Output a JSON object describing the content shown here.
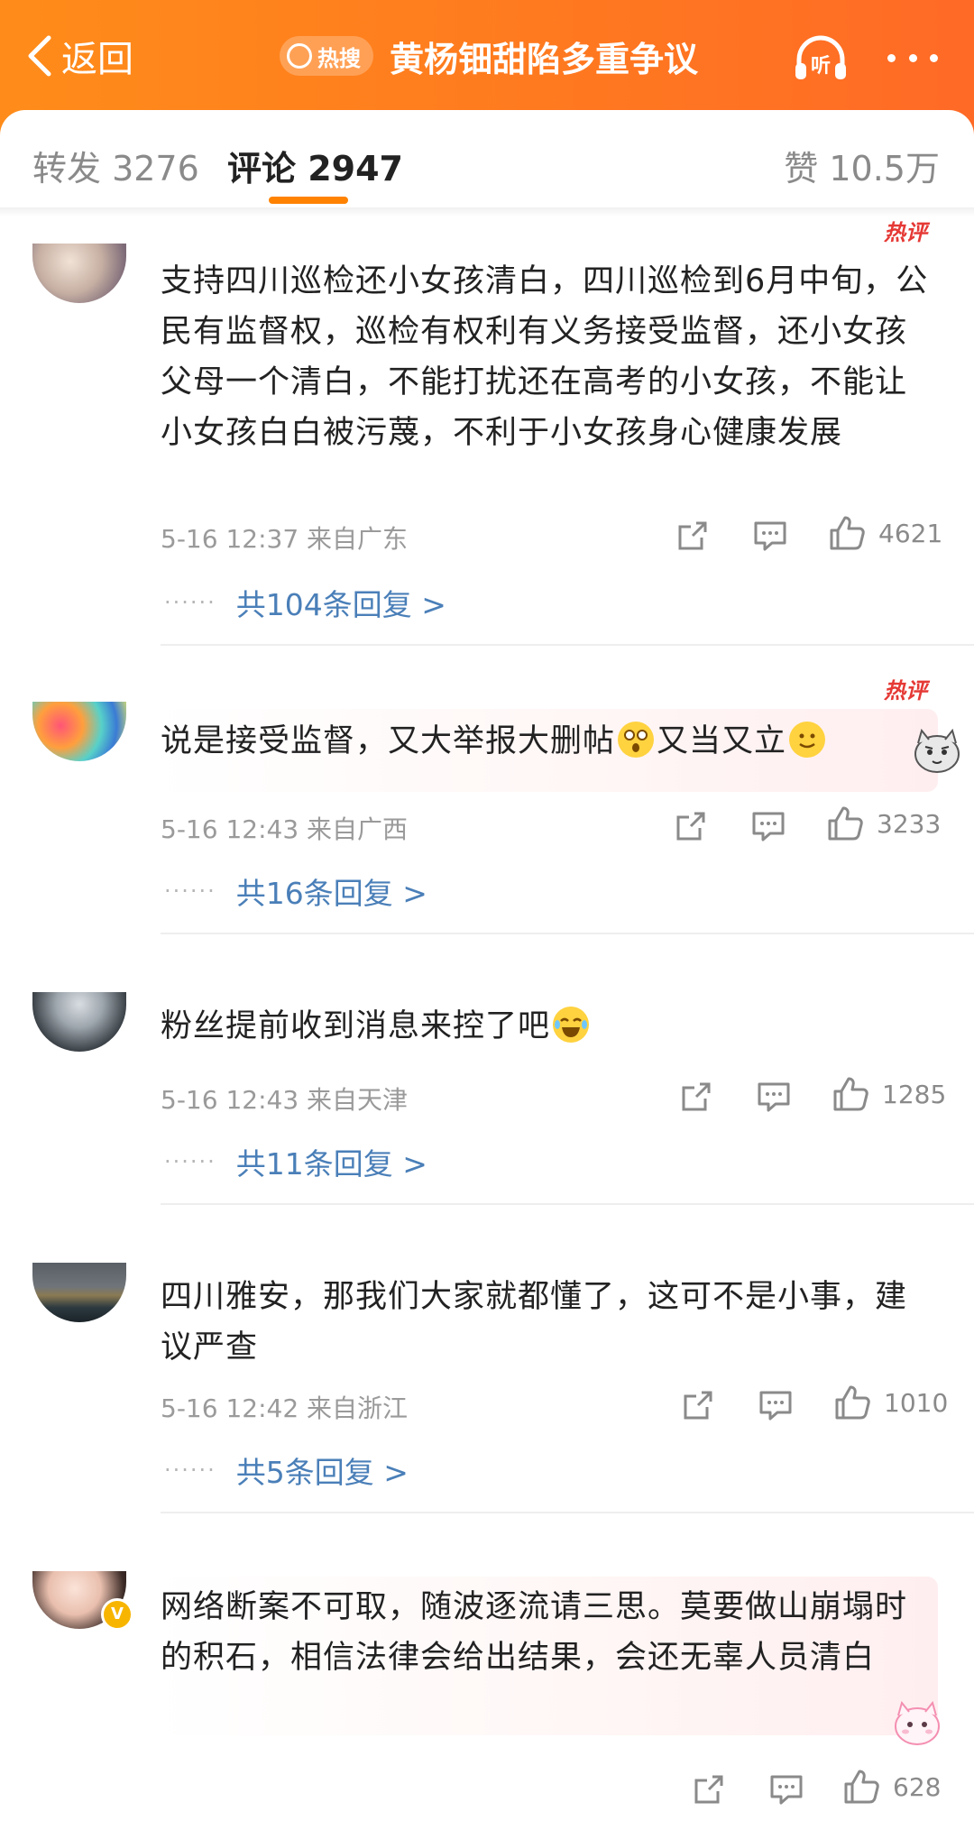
{
  "header": {
    "back_label": "返回",
    "hot_search_tag": "热搜",
    "title": "黄杨钿甜陷多重争议",
    "listen_label": "听",
    "accent_color": "#ff7a1f"
  },
  "tabs": {
    "repost": "转发 3276",
    "comments": "评论 2947",
    "likes": "赞 10.5万"
  },
  "comments": [
    {
      "hot_badge": "热评",
      "text": "支持四川巡检还小女孩清白，四川巡检到6月中旬，公民有监督权，巡检有权利有义务接受监督，还小女孩父母一个清白，不能打扰还在高考的小女孩，不能让小女孩白白被污蔑，不利于小女孩身心健康发展",
      "meta": "5-16 12:37 来自广东",
      "like_count": "4621",
      "replies": "共104条回复 >"
    },
    {
      "hot_badge": "热评",
      "text_a": "说是接受监督，又大举报大删帖",
      "text_b": "又当又立",
      "meta": "5-16 12:43 来自广西",
      "like_count": "3233",
      "replies": "共16条回复 >"
    },
    {
      "text": "粉丝提前收到消息来控了吧",
      "meta": "5-16 12:43 来自天津",
      "like_count": "1285",
      "replies": "共11条回复 >"
    },
    {
      "text": "四川雅安，那我们大家就都懂了，这可不是小事，建议严查",
      "meta": "5-16 12:42 来自浙江",
      "like_count": "1010",
      "replies": "共5条回复 >"
    },
    {
      "text": "网络断案不可取，随波逐流请三思。莫要做山崩塌时的积石，相信法律会给出结果，会还无辜人员清白",
      "like_count": "628",
      "verified_mark": "V"
    }
  ]
}
